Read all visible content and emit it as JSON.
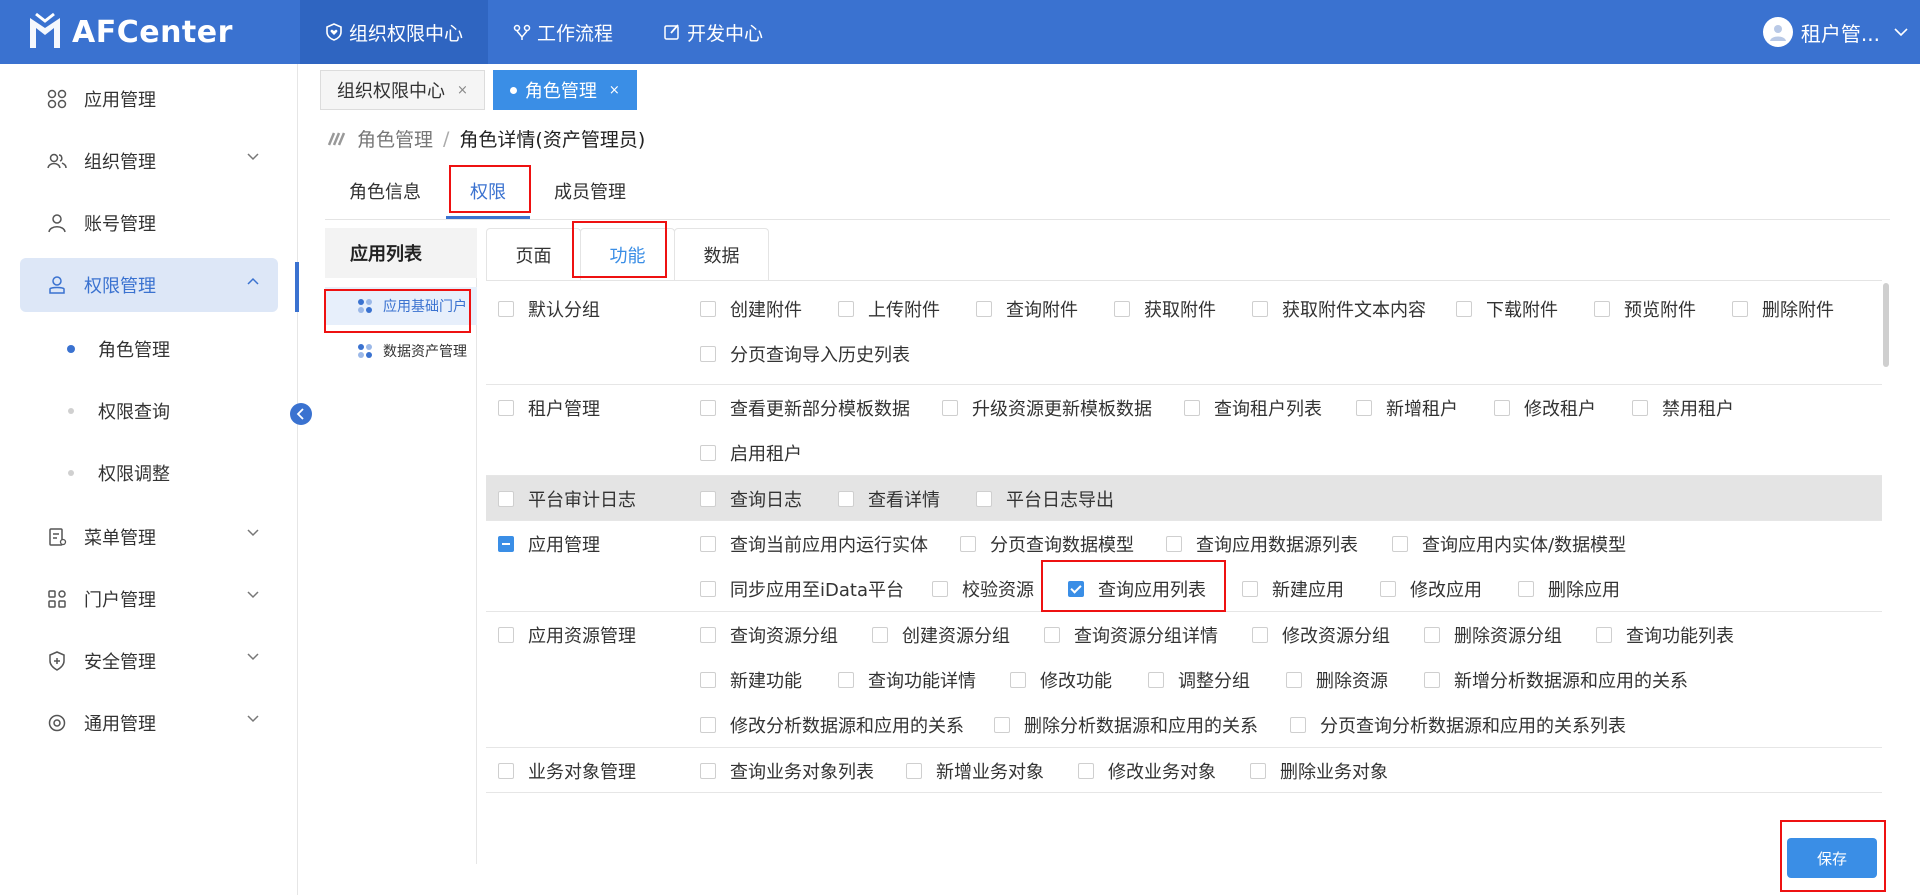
{
  "brand": {
    "name": "AFCenter"
  },
  "topnav": {
    "items": [
      {
        "label": "组织权限中心",
        "icon": "shield-heart-icon"
      },
      {
        "label": "工作流程",
        "icon": "workflow-icon"
      },
      {
        "label": "开发中心",
        "icon": "edit-icon"
      }
    ]
  },
  "user": {
    "name": "租户管..."
  },
  "sidebar": {
    "items": [
      {
        "label": "应用管理",
        "icon": "apps-icon"
      },
      {
        "label": "组织管理",
        "icon": "org-icon"
      },
      {
        "label": "账号管理",
        "icon": "user-icon"
      },
      {
        "label": "权限管理",
        "icon": "permission-icon"
      },
      {
        "label": "菜单管理",
        "icon": "menu-icon"
      },
      {
        "label": "门户管理",
        "icon": "portal-icon"
      },
      {
        "label": "安全管理",
        "icon": "security-icon"
      },
      {
        "label": "通用管理",
        "icon": "settings-icon"
      }
    ],
    "sub_items": [
      {
        "label": "角色管理"
      },
      {
        "label": "权限查询"
      },
      {
        "label": "权限调整"
      }
    ]
  },
  "tags": [
    {
      "label": "组织权限中心",
      "close": "×"
    },
    {
      "label": "角色管理",
      "close": "×"
    }
  ],
  "breadcrumb": {
    "first": "角色管理",
    "separator": "/",
    "last": "角色详情(资产管理员)"
  },
  "subtabs": [
    "角色信息",
    "权限",
    "成员管理"
  ],
  "applist": {
    "title": "应用列表",
    "items": [
      "应用基础门户",
      "数据资产管理"
    ]
  },
  "innertabs": [
    "页面",
    "功能",
    "数据"
  ],
  "groups": [
    {
      "name": "默认分组",
      "perms": [
        "创建附件",
        "上传附件",
        "查询附件",
        "获取附件",
        "获取附件文本内容",
        "下载附件",
        "预览附件",
        "删除附件",
        "分页查询导入历史列表"
      ]
    },
    {
      "name": "租户管理",
      "perms": [
        "查看更新部分模板数据",
        "升级资源更新模板数据",
        "查询租户列表",
        "新增租户",
        "修改租户",
        "禁用租户",
        "启用租户"
      ]
    },
    {
      "name": "平台审计日志",
      "perms": [
        "查询日志",
        "查看详情",
        "平台日志导出"
      ]
    },
    {
      "name": "应用管理",
      "perms": [
        "查询当前应用内运行实体",
        "分页查询数据模型",
        "查询应用数据源列表",
        "查询应用内实体/数据模型",
        "同步应用至iData平台",
        "校验资源",
        "查询应用列表",
        "新建应用",
        "修改应用",
        "删除应用"
      ]
    },
    {
      "name": "应用资源管理",
      "perms": [
        "查询资源分组",
        "创建资源分组",
        "查询资源分组详情",
        "修改资源分组",
        "删除资源分组",
        "查询功能列表",
        "新建功能",
        "查询功能详情",
        "修改功能",
        "调整分组",
        "删除资源",
        "新增分析数据源和应用的关系",
        "修改分析数据源和应用的关系",
        "删除分析数据源和应用的关系",
        "分页查询分析数据源和应用的关系列表"
      ]
    },
    {
      "name": "业务对象管理",
      "perms": [
        "查询业务对象列表",
        "新增业务对象",
        "修改业务对象",
        "删除业务对象"
      ]
    }
  ],
  "save": {
    "label": "保存"
  },
  "colors": {
    "primary": "#3a72d0",
    "accent": "#3a8ee6",
    "highlight": "#e11111"
  }
}
